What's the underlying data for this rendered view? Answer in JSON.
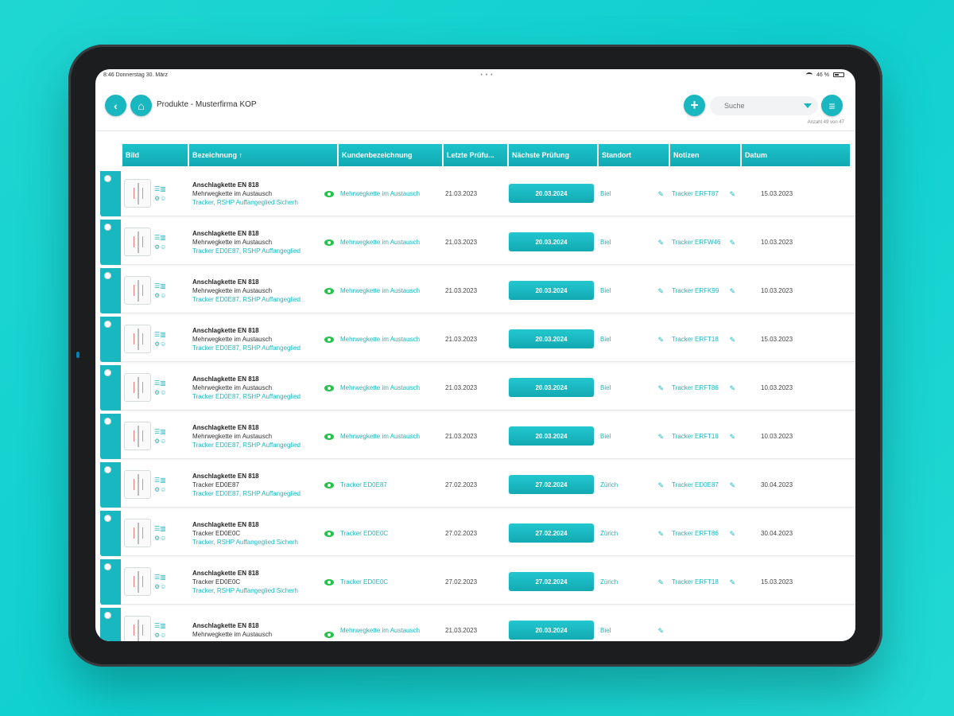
{
  "status": {
    "time": "8:46",
    "date": "Donnerstag 30. März",
    "dots": "• • •",
    "battery": "46 %"
  },
  "header": {
    "title": "Produkte - Musterfirma KOP",
    "search_placeholder": "Suche",
    "count": "Anzahl 49 von 47"
  },
  "icons": {
    "back": "chevron-left-icon",
    "home": "home-icon",
    "add": "plus-icon",
    "menu": "list-icon",
    "filter": "filter-icon",
    "edit": "pencil-icon",
    "view": "eye-icon"
  },
  "colors": {
    "accent": "#19b8c1",
    "view": "#27c24c"
  },
  "table": {
    "columns": [
      "Bild",
      "Bezeichnung ↑",
      "Kundenbezeichnung",
      "Letzte Prüfu...",
      "Nächste Prüfung",
      "Standort",
      "Notizen",
      "Datum"
    ],
    "rows": [
      {
        "title": "Anschlagkette EN 818",
        "sub": "Mehrwegkette im Austausch",
        "link": "Tracker, RSHP Auffangeglied Sicherh",
        "kunde": "Mehrwegkette im Austausch",
        "letzte": "21.03.2023",
        "next": "20.03.2024",
        "standort": "Biel",
        "notiz": "Tracker ERFT87",
        "datum": "15.03.2023"
      },
      {
        "title": "Anschlagkette EN 818",
        "sub": "Mehrwegkette im Austausch",
        "link": "Tracker ED0E87, RSHP Auffangeglied",
        "kunde": "Mehrwegkette im Austausch",
        "letzte": "21.03.2023",
        "next": "20.03.2024",
        "standort": "Biel",
        "notiz": "Tracker ERFW46",
        "datum": "10.03.2023"
      },
      {
        "title": "Anschlagkette EN 818",
        "sub": "Mehrwegkette im Austausch",
        "link": "Tracker ED0E87, RSHP Auffangeglied",
        "kunde": "Mehrwegkette im Austausch",
        "letzte": "21.03.2023",
        "next": "20.03.2024",
        "standort": "Biel",
        "notiz": "Tracker ERFK99",
        "datum": "10.03.2023"
      },
      {
        "title": "Anschlagkette EN 818",
        "sub": "Mehrwegkette im Austausch",
        "link": "Tracker ED0E87, RSHP Auffangeglied",
        "kunde": "Mehrwegkette im Austausch",
        "letzte": "21.03.2023",
        "next": "20.03.2024",
        "standort": "Biel",
        "notiz": "Tracker ERFT18",
        "datum": "15.03.2023"
      },
      {
        "title": "Anschlagkette EN 818",
        "sub": "Mehrwegkette im Austausch",
        "link": "Tracker ED0E87, RSHP Auffangeglied",
        "kunde": "Mehrwegkette im Austausch",
        "letzte": "21.03.2023",
        "next": "20.03.2024",
        "standort": "Biel",
        "notiz": "Tracker ERFT86",
        "datum": "10.03.2023"
      },
      {
        "title": "Anschlagkette EN 818",
        "sub": "Mehrwegkette im Austausch",
        "link": "Tracker ED0E87, RSHP Auffangeglied",
        "kunde": "Mehrwegkette im Austausch",
        "letzte": "21.03.2023",
        "next": "20.03.2024",
        "standort": "Biel",
        "notiz": "Tracker ERFT18",
        "datum": "10.03.2023"
      },
      {
        "title": "Anschlagkette EN 818",
        "sub": "Tracker ED0E87",
        "link": "Tracker ED0E87, RSHP Auffangeglied",
        "kunde": "Tracker ED0E87",
        "letzte": "27.02.2023",
        "next": "27.02.2024",
        "standort": "Zürich",
        "notiz": "Tracker ED0E87",
        "datum": "30.04.2023"
      },
      {
        "title": "Anschlagkette EN 818",
        "sub": "Tracker ED0E0C",
        "link": "Tracker, RSHP Auffangeglied Sicherh",
        "kunde": "Tracker ED0E0C",
        "letzte": "27.02.2023",
        "next": "27.02.2024",
        "standort": "Zürich",
        "notiz": "Tracker ERFT86",
        "datum": "30.04.2023"
      },
      {
        "title": "Anschlagkette EN 818",
        "sub": "Tracker ED0E0C",
        "link": "Tracker, RSHP Auffangeglied Sicherh",
        "kunde": "Tracker ED0E0C",
        "letzte": "27.02.2023",
        "next": "27.02.2024",
        "standort": "Zürich",
        "notiz": "Tracker ERFT18",
        "datum": "15.03.2023"
      },
      {
        "title": "Anschlagkette EN 818",
        "sub": "Mehrwegkette im Austausch",
        "link": "",
        "kunde": "Mehrwegkette im Austausch",
        "letzte": "21.03.2023",
        "next": "20.03.2024",
        "standort": "Biel",
        "notiz": "",
        "datum": ""
      }
    ]
  }
}
